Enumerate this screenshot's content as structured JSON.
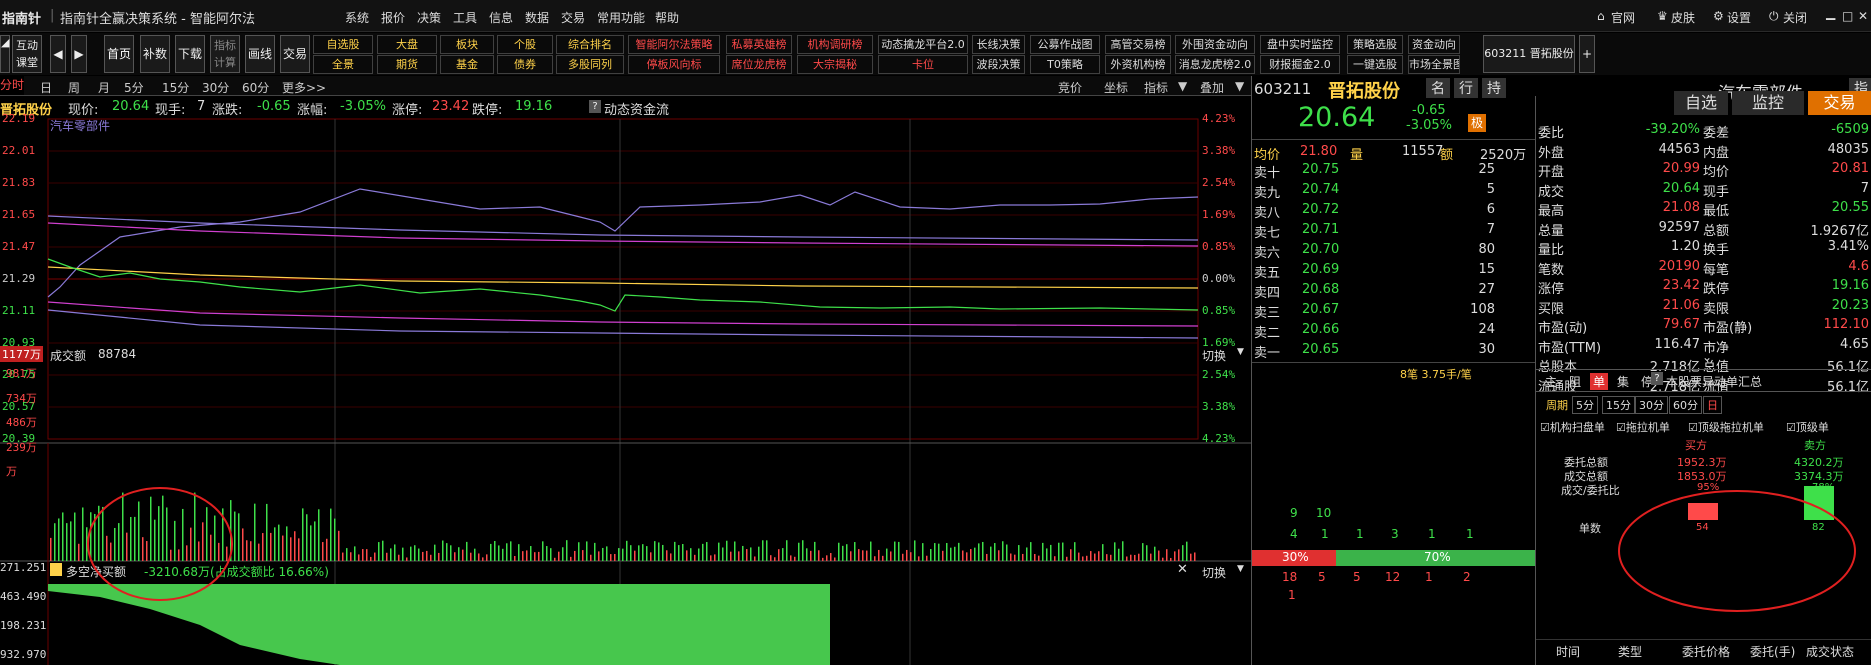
{
  "title": {
    "logo": "指南针",
    "text": "指南针全赢决策系统 - 智能阿尔法"
  },
  "menu": [
    "系统",
    "报价",
    "决策",
    "工具",
    "信息",
    "数据",
    "交易",
    "常用功能",
    "帮助"
  ],
  "win_controls": [
    "官网",
    "皮肤",
    "设置",
    "关闭"
  ],
  "toolbar": {
    "left": [
      "互动课堂"
    ],
    "tabs": [
      "首页",
      "补数",
      "下载",
      "指标计算",
      "画线",
      "交易"
    ],
    "grid_row1": [
      "自选股",
      "大盘",
      "板块",
      "个股",
      "综合排名",
      "智能阿尔法策略",
      "私募英雄榜",
      "机构调研榜",
      "动态擒龙平台2.0",
      "长线决策",
      "公募作战图",
      "高管交易榜",
      "外围资金动向",
      "盘中实时监控",
      "策略选股",
      "资金动向"
    ],
    "grid_row2": [
      "全景",
      "期货",
      "基金",
      "债券",
      "多股同列",
      "停板风向标",
      "席位龙虎榜",
      "大宗揭秘",
      "卡位",
      "波段决策",
      "T0策略",
      "外资机构榜",
      "消息龙虎榜2.0",
      "财报掘金2.0",
      "一键选股",
      "市场全景图"
    ],
    "stock_tab": "603211 晋拓股份"
  },
  "period": {
    "items": [
      "分时",
      "日",
      "周",
      "月",
      "5分",
      "15分",
      "30分",
      "60分",
      "更多>>"
    ],
    "right": [
      "竞价",
      "坐标",
      "指标",
      "叠加"
    ]
  },
  "header": {
    "name": "晋拓股份",
    "price_label": "现价:",
    "price": "20.64",
    "hand_label": "现手:",
    "hand": "7",
    "chg_label": "涨跌:",
    "chg": "-0.65",
    "pct_label": "涨幅:",
    "pct": "-3.05%",
    "up_label": "涨停:",
    "up": "23.42",
    "down_label": "跌停:",
    "down": "19.16",
    "flow": "动态资金流"
  },
  "main_chart": {
    "left_axis": [
      "22.19",
      "22.01",
      "21.83",
      "21.65",
      "21.47",
      "21.29",
      "21.11",
      "20.93",
      "20.75",
      "20.57",
      "20.39"
    ],
    "right_axis": [
      "4.23%",
      "3.38%",
      "2.54%",
      "1.69%",
      "0.85%",
      "0.00%",
      "0.85%",
      "1.69%",
      "2.54%",
      "3.38%",
      "4.23%"
    ],
    "sector_label": "汽车零部件"
  },
  "vol_chart": {
    "top_label": "1177万",
    "title": "成交额",
    "value": "88784",
    "axis": [
      "981万",
      "734万",
      "486万",
      "239万",
      "万"
    ],
    "switch": "切换"
  },
  "net_chart": {
    "title": "多空净买额",
    "value": "-3210.68万(占成交额比 16.66%)",
    "axis": [
      "271.251",
      "463.490",
      "198.231",
      "932.970"
    ],
    "switch": "切换"
  },
  "quote": {
    "code": "603211",
    "name": "晋拓股份",
    "tags": [
      "名",
      "行",
      "持"
    ],
    "sector": "汽车零部件",
    "sector_tags": [
      "指",
      "股"
    ],
    "price": "20.64",
    "chg": "-0.65",
    "pct": "-3.05%",
    "badge": "极",
    "actions": [
      "自选",
      "监控",
      "交易"
    ],
    "avg_label": "均价",
    "avg": "21.80",
    "vol_label": "量",
    "vol": "11557",
    "amt_label": "额",
    "amt": "2520万",
    "sells": [
      [
        "卖十",
        "20.75",
        "25"
      ],
      [
        "卖九",
        "20.74",
        "5"
      ],
      [
        "卖八",
        "20.72",
        "6"
      ],
      [
        "卖七",
        "20.71",
        "7"
      ],
      [
        "卖六",
        "20.70",
        "80"
      ],
      [
        "卖五",
        "20.69",
        "15"
      ],
      [
        "卖四",
        "20.68",
        "27"
      ],
      [
        "卖三",
        "20.67",
        "108"
      ],
      [
        "卖二",
        "20.66",
        "24"
      ],
      [
        "卖一",
        "20.65",
        "30"
      ]
    ],
    "ticks_note": "8笔 3.75手/笔",
    "bar_top": [
      "9",
      "10"
    ],
    "bar_mid": [
      "4",
      "1",
      "1",
      "3",
      "1",
      "1"
    ],
    "ratio_left": "30%",
    "ratio_right": "70%",
    "bar_bottom": [
      "18",
      "5",
      "5",
      "12",
      "1",
      "2"
    ],
    "bar_bottom2": "1"
  },
  "stats": [
    [
      "委比",
      "-39.20%",
      "委差",
      "-6509"
    ],
    [
      "外盘",
      "44563",
      "内盘",
      "48035"
    ],
    [
      "开盘",
      "20.99",
      "均价",
      "20.81"
    ],
    [
      "成交",
      "20.64",
      "现手",
      "7"
    ],
    [
      "最高",
      "21.08",
      "最低",
      "20.55"
    ],
    [
      "总量",
      "92597",
      "总额",
      "1.9267亿"
    ],
    [
      "量比",
      "1.20",
      "换手",
      "3.41%"
    ],
    [
      "笔数",
      "20190",
      "每笔",
      "4.6"
    ],
    [
      "涨停",
      "23.42",
      "跌停",
      "19.16"
    ],
    [
      "买限",
      "21.06",
      "卖限",
      "20.23"
    ],
    [
      "市盈(动)",
      "79.67",
      "市盈(静)",
      "112.10"
    ],
    [
      "市盈(TTM)",
      "116.47",
      "市净",
      "4.65"
    ],
    [
      "总股本",
      "2.718亿",
      "总值",
      "56.1亿"
    ],
    [
      "流通股",
      "2.718亿",
      "流值",
      "56.1亿"
    ]
  ],
  "order": {
    "tabs": [
      "主",
      "阻",
      "单",
      "集",
      "停"
    ],
    "title": "本股票异动单汇总",
    "periods": [
      "周期",
      "5分",
      "15分",
      "30分",
      "60分",
      "日"
    ],
    "checks": [
      "机构扫盘单",
      "拖拉机单",
      "顶级拖拉机单",
      "顶级单"
    ],
    "buy_label": "买方",
    "sell_label": "卖方",
    "rows": [
      [
        "委托总额",
        "1952.3万",
        "4320.2万"
      ],
      [
        "成交总额",
        "1853.0万",
        "3374.3万"
      ]
    ],
    "ratio_label": "成交/委托比",
    "ratio_buy": "95%",
    "ratio_sell": "78%",
    "count_label": "单数",
    "count_buy": "54",
    "count_sell": "82",
    "columns": [
      "时间",
      "类型",
      "委托价格",
      "委托(手)",
      "成交状态"
    ]
  },
  "colors": {
    "up": "#ff4a4a",
    "down": "#3ee04a",
    "accent": "#ffd24a",
    "highlight": "#e03030"
  }
}
